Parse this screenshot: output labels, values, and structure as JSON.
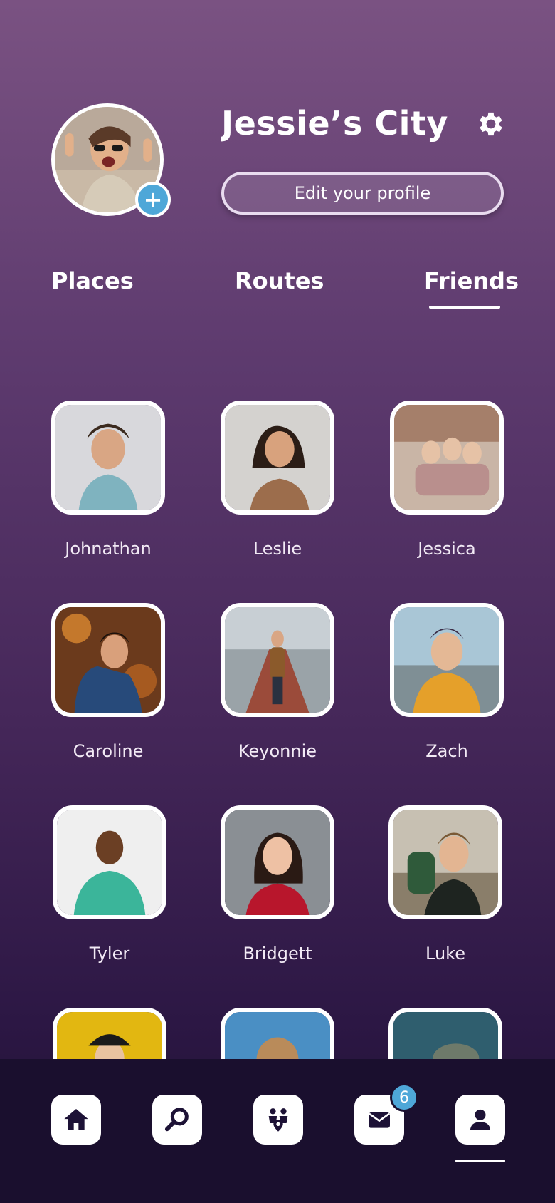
{
  "profile": {
    "name": "Jessie’s City…",
    "edit_label": "Edit your profile",
    "add_photo_symbol": "+"
  },
  "tabs": [
    {
      "label": "Places",
      "active": false
    },
    {
      "label": "Routes",
      "active": false
    },
    {
      "label": "Friends",
      "active": true
    }
  ],
  "friends": [
    {
      "name": "Johnathan"
    },
    {
      "name": "Leslie"
    },
    {
      "name": "Jessica"
    },
    {
      "name": "Caroline"
    },
    {
      "name": "Keyonnie"
    },
    {
      "name": "Zach"
    },
    {
      "name": "Tyler"
    },
    {
      "name": "Bridgett"
    },
    {
      "name": "Luke"
    }
  ],
  "nav": {
    "items": [
      "home-icon",
      "search-icon",
      "community-icon",
      "mail-icon",
      "profile-icon"
    ],
    "mail_badge": "6",
    "active": "profile-icon"
  },
  "colors": {
    "accent": "#4ea7d8",
    "nav_bg": "#1a0f2e",
    "icon_dark": "#1d1236"
  }
}
